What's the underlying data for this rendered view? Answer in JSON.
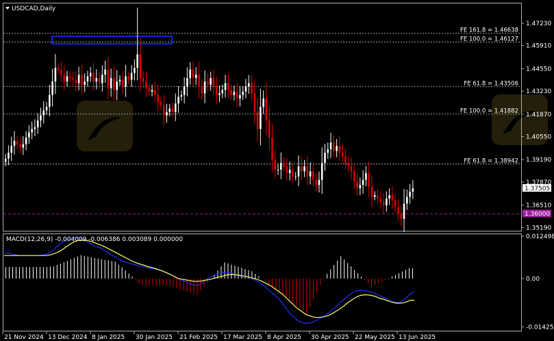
{
  "window": {
    "title": "USDCAD,Daily"
  },
  "chart_data": {
    "type": "candlestick",
    "symbol": "USDCAD",
    "timeframe": "Daily",
    "ylim": [
      1.35,
      1.484
    ],
    "price_ticks": [
      "1.47230",
      "1.45910",
      "1.44550",
      "1.43230",
      "1.41870",
      "1.40550",
      "1.39190",
      "1.37870",
      "1.36510",
      "1.35190"
    ],
    "date_labels": [
      "21 Nov 2024",
      "13 Dec 2024",
      "8 Jan 2025",
      "30 Jan 2025",
      "21 Feb 2025",
      "17 Mar 2025",
      "8 Apr 2025",
      "30 Apr 2025",
      "22 May 2025",
      "13 Jun 2025"
    ],
    "current_price": "1.37505",
    "marked_level": "1.36000",
    "fib_levels": [
      {
        "label": "FE 161.8 = 1.46638",
        "value": 1.46638
      },
      {
        "label": "FE 100.0 = 1.46127",
        "value": 1.46127
      },
      {
        "label": "FE 61.8 = 1.43506",
        "value": 1.43506
      },
      {
        "label": "FE 100.0 = 1.41882",
        "value": 1.41882
      },
      {
        "label": "FE 61.8 = 1.38942",
        "value": 1.38942
      }
    ],
    "close": [
      1.3925,
      1.396,
      1.4,
      1.403,
      1.401,
      1.399,
      1.401,
      1.405,
      1.408,
      1.41,
      1.411,
      1.415,
      1.418,
      1.421,
      1.423,
      1.43,
      1.438,
      1.446,
      1.445,
      1.442,
      1.438,
      1.441,
      1.44,
      1.439,
      1.437,
      1.442,
      1.436,
      1.438,
      1.441,
      1.443,
      1.438,
      1.44,
      1.437,
      1.442,
      1.445,
      1.434,
      1.44,
      1.433,
      1.438,
      1.439,
      1.435,
      1.441,
      1.439,
      1.443,
      1.446,
      1.454,
      1.44,
      1.438,
      1.434,
      1.432,
      1.433,
      1.43,
      1.426,
      1.424,
      1.418,
      1.42,
      1.422,
      1.42,
      1.425,
      1.429,
      1.43,
      1.435,
      1.44,
      1.445,
      1.44,
      1.442,
      1.435,
      1.431,
      1.438,
      1.436,
      1.44,
      1.435,
      1.43,
      1.431,
      1.433,
      1.437,
      1.433,
      1.43,
      1.432,
      1.428,
      1.43,
      1.432,
      1.435,
      1.437,
      1.431,
      1.42,
      1.41,
      1.423,
      1.428,
      1.415,
      1.405,
      1.392,
      1.386,
      1.386,
      1.39,
      1.388,
      1.384,
      1.386,
      1.382,
      1.382,
      1.388,
      1.385,
      1.388,
      1.382,
      1.385,
      1.38,
      1.377,
      1.38,
      1.39,
      1.396,
      1.398,
      1.402,
      1.397,
      1.4,
      1.396,
      1.394,
      1.39,
      1.388,
      1.385,
      1.379,
      1.375,
      1.377,
      1.38,
      1.384,
      1.376,
      1.37,
      1.371,
      1.369,
      1.367,
      1.365,
      1.369,
      1.371,
      1.368,
      1.364,
      1.36,
      1.357,
      1.366,
      1.37,
      1.373,
      1.375
    ]
  },
  "macd": {
    "label": "MACD(12,26,9) -0.004009 -0.006386 0.003089 0.000000",
    "ylim": [
      -0.0154,
      0.0131
    ],
    "ticks": [
      "0.012498",
      "0.00",
      "-0.014259"
    ],
    "hist": [
      0.0034,
      0.0034,
      0.0034,
      0.0034,
      0.0034,
      0.0034,
      0.0034,
      0.0034,
      0.0034,
      0.0034,
      0.0034,
      0.0034,
      0.0034,
      0.0035,
      0.0036,
      0.004,
      0.0044,
      0.0048,
      0.0052,
      0.0057,
      0.0061,
      0.0065,
      0.0069,
      0.0067,
      0.0065,
      0.0063,
      0.0061,
      0.0059,
      0.0057,
      0.0055,
      0.0054,
      0.0052,
      0.005,
      0.0041,
      0.0033,
      0.0024,
      0.0015,
      0.0006,
      -0.0003,
      -0.0012,
      -0.0021,
      -0.0021,
      -0.0021,
      -0.0021,
      -0.0021,
      -0.0021,
      -0.0021,
      -0.0021,
      -0.0021,
      -0.0024,
      -0.0028,
      -0.0031,
      -0.0034,
      -0.0037,
      -0.0041,
      -0.0044,
      -0.0047,
      -0.0035,
      -0.0024,
      -0.0012,
      0.0,
      0.0012,
      0.0024,
      0.0036,
      0.0048,
      0.0045,
      0.0041,
      0.0038,
      0.0035,
      0.0032,
      0.0028,
      0.0025,
      0.0022,
      0.0014,
      0.0007,
      -0.0001,
      -0.0009,
      -0.0017,
      -0.0024,
      -0.0032,
      -0.004,
      -0.0048,
      -0.0056,
      -0.0064,
      -0.0072,
      -0.008,
      -0.0088,
      -0.0096,
      -0.0104,
      -0.0083,
      -0.0062,
      -0.0041,
      -0.002,
      0.0001,
      0.0014,
      0.0027,
      0.004,
      0.0053,
      0.0066,
      0.0056,
      0.0046,
      0.0036,
      0.0026,
      0.0016,
      0.0006,
      -0.0004,
      -0.0014,
      -0.0024,
      -0.0019,
      -0.0014,
      -0.0009,
      -0.0004,
      0.0001,
      0.0006,
      0.0011,
      0.0016,
      0.0021,
      0.0026,
      0.0031,
      0.003
    ],
    "macd_line": [
      0.0075,
      0.0075,
      0.0072,
      0.007,
      0.0068,
      0.0068,
      0.0068,
      0.0068,
      0.0068,
      0.0068,
      0.007,
      0.0072,
      0.0078,
      0.0088,
      0.0098,
      0.0108,
      0.0113,
      0.0117,
      0.012,
      0.012,
      0.0118,
      0.0112,
      0.0105,
      0.0098,
      0.0094,
      0.009,
      0.0083,
      0.0075,
      0.0068,
      0.0062,
      0.0055,
      0.005,
      0.0046,
      0.0043,
      0.004,
      0.0037,
      0.0035,
      0.0032,
      0.003,
      0.0028,
      0.0025,
      0.0022,
      0.0018,
      0.0012,
      0.0006,
      0.0,
      -0.0005,
      -0.001,
      -0.0015,
      -0.002,
      -0.002,
      -0.0015,
      -0.0005,
      0.0002,
      0.0008,
      0.0012,
      0.0016,
      0.0018,
      0.0019,
      0.0016,
      0.0012,
      0.0008,
      0.0006,
      0.0004,
      0.0,
      -0.0005,
      -0.0012,
      -0.002,
      -0.003,
      -0.004,
      -0.005,
      -0.006,
      -0.0075,
      -0.009,
      -0.0105,
      -0.0115,
      -0.0125,
      -0.013,
      -0.0132,
      -0.0131,
      -0.0128,
      -0.0122,
      -0.0115,
      -0.0108,
      -0.01,
      -0.009,
      -0.008,
      -0.007,
      -0.006,
      -0.005,
      -0.0042,
      -0.0037,
      -0.0035,
      -0.0035,
      -0.0037,
      -0.004,
      -0.0045,
      -0.005,
      -0.0056,
      -0.006,
      -0.0065,
      -0.007,
      -0.007,
      -0.0065,
      -0.0055,
      -0.0045,
      -0.004
    ],
    "signal_line": [
      0.0068,
      0.0068,
      0.0068,
      0.0068,
      0.0068,
      0.0068,
      0.0068,
      0.0068,
      0.0068,
      0.0068,
      0.0068,
      0.0068,
      0.007,
      0.0074,
      0.0078,
      0.0085,
      0.0093,
      0.0101,
      0.0108,
      0.0112,
      0.0113,
      0.0113,
      0.0111,
      0.0108,
      0.0103,
      0.0099,
      0.0094,
      0.0088,
      0.0082,
      0.0076,
      0.007,
      0.0064,
      0.0058,
      0.0052,
      0.0047,
      0.0043,
      0.004,
      0.0036,
      0.0033,
      0.003,
      0.0026,
      0.0022,
      0.0017,
      0.0012,
      0.0006,
      0.0,
      -0.0002,
      -0.0004,
      -0.0006,
      -0.0008,
      -0.0008,
      -0.0007,
      -0.0005,
      -0.0003,
      0.0,
      0.0003,
      0.0006,
      0.0009,
      0.0012,
      0.0012,
      0.0011,
      0.0009,
      0.0007,
      0.0005,
      0.0002,
      -0.0001,
      -0.0005,
      -0.001,
      -0.0016,
      -0.0022,
      -0.003,
      -0.0038,
      -0.0047,
      -0.0058,
      -0.0069,
      -0.008,
      -0.009,
      -0.0098,
      -0.0106,
      -0.011,
      -0.0114,
      -0.0115,
      -0.0114,
      -0.0112,
      -0.0108,
      -0.0102,
      -0.0095,
      -0.0088,
      -0.0079,
      -0.007,
      -0.0062,
      -0.0055,
      -0.005,
      -0.0048,
      -0.0048,
      -0.005,
      -0.0053,
      -0.0058,
      -0.0061,
      -0.0065,
      -0.0069,
      -0.0072,
      -0.0073,
      -0.0072,
      -0.0069,
      -0.0064,
      -0.0064
    ]
  },
  "colors": {
    "background": "#000000",
    "grid": "#ffffff",
    "bull": "#ffffff",
    "bear": "#e00000",
    "fib_line": "#c8c8c8",
    "marked_line": "#a020a0",
    "marked_label_bg": "#a020a0",
    "current_label_bg": "#ffffff",
    "hist_pos": "#ffffff",
    "hist_neg": "#e00000",
    "macd": "#1f2fff",
    "signal": "#ffff66",
    "box": "#2030ff"
  }
}
